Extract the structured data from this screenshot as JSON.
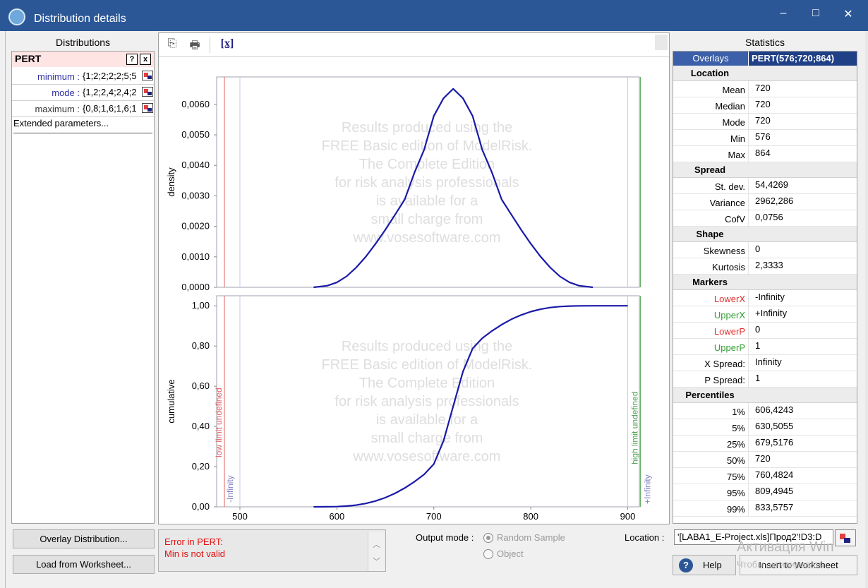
{
  "window": {
    "title": "Distribution details",
    "minimize": "–",
    "maximize": "□",
    "close": "✕"
  },
  "left_panel": {
    "title": "Distributions",
    "dist_name": "PERT",
    "help_btn": "?",
    "close_btn": "x",
    "params": [
      {
        "label": "minimum :",
        "value": "{1;2;2;2;2;5;5"
      },
      {
        "label": "mode :",
        "value": "{1,2;2,4;2,4;2"
      },
      {
        "label": "maximum :",
        "value": "{0,8;1,6;1,6;1"
      }
    ],
    "extended": "Extended parameters..."
  },
  "chart_data": [
    {
      "type": "line",
      "title": "",
      "xlabel": "",
      "ylabel": "density",
      "xlim": [
        476,
        912
      ],
      "ylim": [
        0,
        0.0069
      ],
      "yticks": [
        "0,0000",
        "0,0010",
        "0,0020",
        "0,0030",
        "0,0040",
        "0,0050",
        "0,0060"
      ],
      "series": [
        {
          "name": "PERT(576;720;864)",
          "x": [
            576,
            590,
            600,
            610,
            620,
            630,
            640,
            650,
            660,
            670,
            680,
            690,
            700,
            710,
            720,
            730,
            740,
            750,
            760,
            770,
            780,
            790,
            800,
            810,
            820,
            830,
            840,
            850,
            864
          ],
          "y": [
            0,
            5e-05,
            0.00016,
            0.00036,
            0.00065,
            0.00101,
            0.00143,
            0.00189,
            0.00238,
            0.00288,
            0.00376,
            0.00451,
            0.00562,
            0.0062,
            0.00651,
            0.0062,
            0.00562,
            0.00451,
            0.00376,
            0.00288,
            0.00238,
            0.00189,
            0.00143,
            0.00101,
            0.00065,
            0.00036,
            0.00016,
            5e-05,
            0
          ]
        }
      ],
      "line_color": "#1a1aa8"
    },
    {
      "type": "line",
      "title": "",
      "xlabel": "",
      "ylabel": "cumulative",
      "xlim": [
        476,
        912
      ],
      "ylim": [
        0,
        1.05
      ],
      "yticks": [
        "0,00",
        "0,20",
        "0,40",
        "0,60",
        "0,80",
        "1,00"
      ],
      "xticks": [
        "500",
        "600",
        "700",
        "800",
        "900"
      ],
      "series": [
        {
          "name": "PERT(576;720;864)",
          "x": [
            576,
            590,
            600,
            610,
            620,
            630,
            640,
            650,
            660,
            670,
            680,
            690,
            700,
            710,
            720,
            730,
            740,
            750,
            760,
            770,
            780,
            790,
            800,
            810,
            820,
            830,
            840,
            850,
            864,
            900
          ],
          "y": [
            0,
            0.0003,
            0.0012,
            0.0038,
            0.0086,
            0.0169,
            0.0291,
            0.0457,
            0.0671,
            0.0935,
            0.1249,
            0.1612,
            0.2125,
            0.328,
            0.5,
            0.672,
            0.7875,
            0.8388,
            0.8751,
            0.9065,
            0.9329,
            0.9543,
            0.9709,
            0.9831,
            0.9914,
            0.9962,
            0.9988,
            0.9997,
            1.0,
            1.0
          ]
        }
      ],
      "line_color": "#1a1aa8"
    }
  ],
  "chart_markers": {
    "low_label": "low limit undefined",
    "high_label": "high limit undefined",
    "low_inf": "-Infinity",
    "high_inf": "+Infinity",
    "low_color": "#e06060",
    "high_color": "#50a050",
    "band_color": "#c8c8f0"
  },
  "watermark": [
    "Results produced using the",
    "FREE Basic edition of ModelRisk.",
    "The Complete Edition",
    "for risk analysis professionals",
    "is available for a",
    "small charge from",
    "www.vosesoftware.com"
  ],
  "stats": {
    "title": "Statistics",
    "overlays_label": "Overlays",
    "overlays_value": "PERT(576;720;864)",
    "sections": [
      {
        "name": "Location",
        "rows": [
          [
            "Mean",
            "720"
          ],
          [
            "Median",
            "720"
          ],
          [
            "Mode",
            "720"
          ],
          [
            "Min",
            "576"
          ],
          [
            "Max",
            "864"
          ]
        ]
      },
      {
        "name": "Spread",
        "rows": [
          [
            "St. dev.",
            "54,4269"
          ],
          [
            "Variance",
            "2962,286"
          ],
          [
            "CofV",
            "0,0756"
          ]
        ]
      },
      {
        "name": "Shape",
        "rows": [
          [
            "Skewness",
            "0"
          ],
          [
            "Kurtosis",
            "2,3333"
          ]
        ]
      },
      {
        "name": "Markers",
        "rows": [
          [
            "LowerX",
            "-Infinity"
          ],
          [
            "UpperX",
            "+Infinity"
          ],
          [
            "LowerP",
            "0"
          ],
          [
            "UpperP",
            "1"
          ],
          [
            "X Spread:",
            "Infinity"
          ],
          [
            "P Spread:",
            "1"
          ]
        ]
      },
      {
        "name": "Percentiles",
        "rows": [
          [
            "1%",
            "606,4243"
          ],
          [
            "5%",
            "630,5055"
          ],
          [
            "25%",
            "679,5176"
          ],
          [
            "50%",
            "720"
          ],
          [
            "75%",
            "760,4824"
          ],
          [
            "95%",
            "809,4945"
          ],
          [
            "99%",
            "833,5757"
          ]
        ]
      }
    ],
    "marker_colors": {
      "LowerX": "#e03030",
      "UpperX": "#30a030",
      "LowerP": "#e03030",
      "UpperP": "#30a030"
    }
  },
  "bottom": {
    "overlay_btn": "Overlay Distribution...",
    "load_btn": "Load from Worksheet...",
    "error_line1": "Error in PERT:",
    "error_line2": "Min is not valid",
    "output_mode_label": "Output mode :",
    "radio_random": "Random Sample",
    "radio_object": "Object",
    "location_label": "Location :",
    "location_value": "'[LABA1_E-Project.xls]Прод2'!D3:D",
    "help_btn": "Help",
    "insert_btn": "Insert to Worksheet",
    "win_activate": "Активация Win",
    "win_activate2": "Чтобы активировать"
  }
}
